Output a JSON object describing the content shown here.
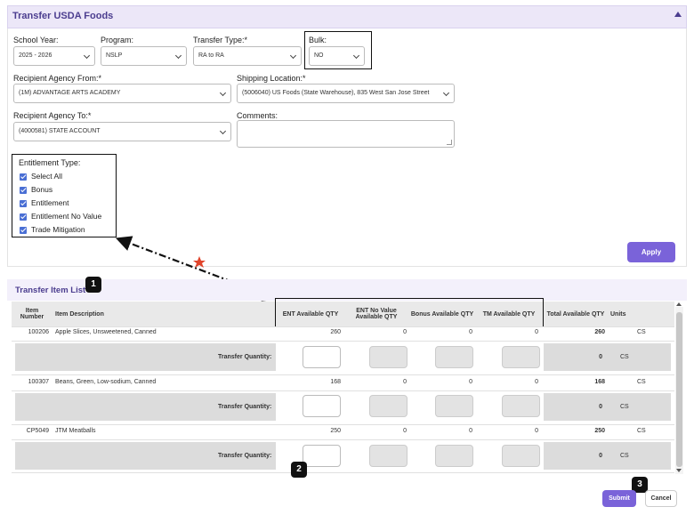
{
  "panel": {
    "title": "Transfer USDA Foods"
  },
  "form": {
    "school_year": {
      "label": "School Year:",
      "value": "2025 - 2026"
    },
    "program": {
      "label": "Program:",
      "value": "NSLP"
    },
    "transfer_type": {
      "label": "Transfer Type:*",
      "value": "RA to RA"
    },
    "bulk": {
      "label": "Bulk:",
      "value": "NO"
    },
    "recipient_from": {
      "label": "Recipient Agency From:*",
      "value": "(1M) ADVANTAGE ARTS ACADEMY"
    },
    "shipping_location": {
      "label": "Shipping Location:*",
      "value": "(5006040) US Foods (State Warehouse), 835 West San Jose Street"
    },
    "recipient_to": {
      "label": "Recipient Agency To:*",
      "value": "(4000581) STATE ACCOUNT"
    },
    "comments": {
      "label": "Comments:",
      "value": ""
    },
    "entitlement_type": {
      "label": "Entitlement Type:",
      "options": [
        "Select All",
        "Bonus",
        "Entitlement",
        "Entitlement No Value",
        "Trade Mitigation"
      ]
    },
    "apply_label": "Apply"
  },
  "list": {
    "title": "Transfer Item List",
    "columns": {
      "item_number": "Item Number",
      "item_description": "Item Description",
      "ent_available": "ENT Available QTY",
      "ent_no_value": "ENT No Value Available QTY",
      "bonus_available": "Bonus Available QTY",
      "tm_available": "TM Available QTY",
      "total_available": "Total Available QTY",
      "units": "Units"
    },
    "transfer_quantity_label": "Transfer Quantity:",
    "items": [
      {
        "number": "100206",
        "description": "Apple Slices, Unsweetened, Canned",
        "ent": "260",
        "ent_nv": "0",
        "bonus": "0",
        "tm": "0",
        "total": "260",
        "units": "CS",
        "transfer_total": "0",
        "transfer_units": "CS"
      },
      {
        "number": "100307",
        "description": "Beans, Green, Low-sodium, Canned",
        "ent": "168",
        "ent_nv": "0",
        "bonus": "0",
        "tm": "0",
        "total": "168",
        "units": "CS",
        "transfer_total": "0",
        "transfer_units": "CS"
      },
      {
        "number": "CP5049",
        "description": "JTM Meatballs",
        "ent": "250",
        "ent_nv": "0",
        "bonus": "0",
        "tm": "0",
        "total": "250",
        "units": "CS",
        "transfer_total": "0",
        "transfer_units": "CS"
      }
    ]
  },
  "annotations": {
    "badge1": "1",
    "badge2": "2",
    "badge3": "3"
  },
  "actions": {
    "submit_label": "Submit",
    "cancel_label": "Cancel"
  },
  "colors": {
    "accent": "#7a63d9",
    "header_bg": "#ece7f8",
    "title": "#4b3d8f",
    "checkbox": "#4a6fd4",
    "star": "#e0442b"
  }
}
